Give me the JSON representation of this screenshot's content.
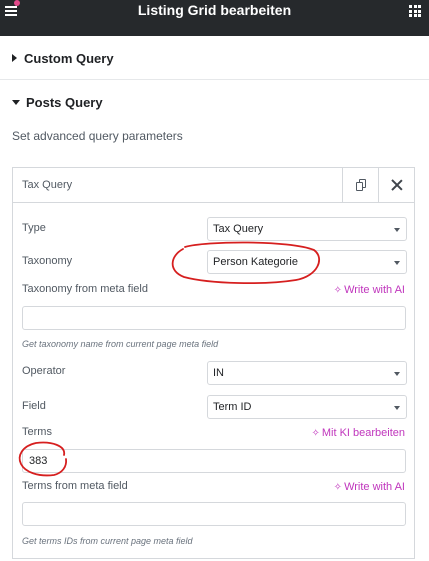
{
  "header": {
    "title": "Listing Grid bearbeiten",
    "menu_icon": "hamburger-icon",
    "apps_icon": "grid-icon"
  },
  "sections": {
    "custom_query": {
      "label": "Custom Query"
    },
    "posts_query": {
      "label": "Posts Query",
      "description": "Set advanced query parameters"
    }
  },
  "repeater": {
    "title": "Tax Query",
    "type": {
      "label": "Type",
      "value": "Tax Query"
    },
    "taxonomy": {
      "label": "Taxonomy",
      "value": "Person Kategorie"
    },
    "taxonomy_meta": {
      "label": "Taxonomy from meta field",
      "ai_label": "Write with AI",
      "value": "",
      "hint": "Get taxonomy name from current page meta field"
    },
    "operator": {
      "label": "Operator",
      "value": "IN"
    },
    "field": {
      "label": "Field",
      "value": "Term ID"
    },
    "terms": {
      "label": "Terms",
      "ai_label": "Mit KI bearbeiten",
      "value": "383"
    },
    "terms_meta": {
      "label": "Terms from meta field",
      "ai_label": "Write with AI",
      "value": "",
      "hint": "Get terms IDs from current page meta field"
    }
  },
  "colors": {
    "header_bg": "#26292c",
    "ai_accent": "#c036bd",
    "annotation": "#d61f1f",
    "badge": "#e2498a"
  }
}
